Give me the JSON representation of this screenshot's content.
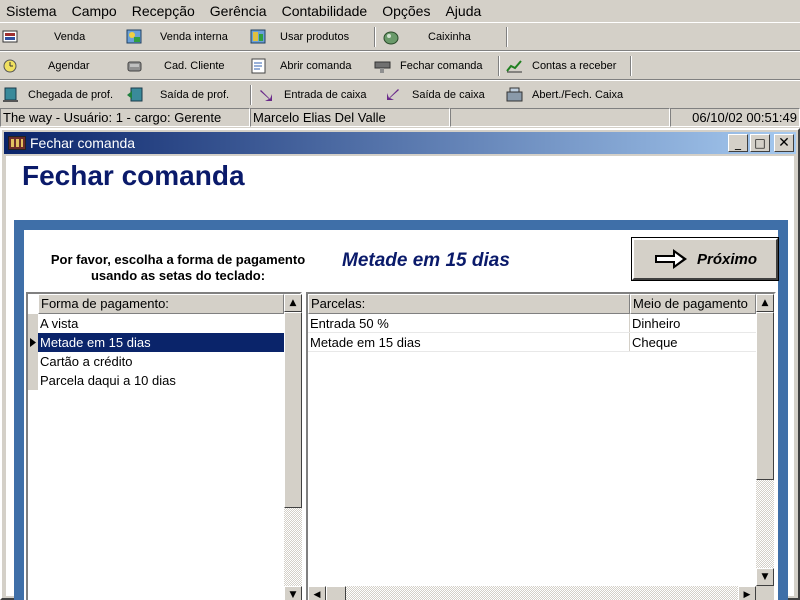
{
  "menu": [
    "Sistema",
    "Campo",
    "Recepção",
    "Gerência",
    "Contabilidade",
    "Opções",
    "Ajuda"
  ],
  "toolbar": {
    "row1": [
      {
        "label": "Venda",
        "icon": "sale-icon"
      },
      {
        "label": "Venda interna",
        "icon": "internal-sale-icon"
      },
      {
        "label": "Usar produtos",
        "icon": "products-icon"
      },
      {
        "label": "Caixinha",
        "icon": "tip-box-icon"
      }
    ],
    "row2": [
      {
        "label": "Agendar",
        "icon": "schedule-icon"
      },
      {
        "label": "Cad. Cliente",
        "icon": "client-register-icon"
      },
      {
        "label": "Abrir comanda",
        "icon": "open-order-icon"
      },
      {
        "label": "Fechar comanda",
        "icon": "close-order-icon"
      },
      {
        "label": "Contas a receber",
        "icon": "receivables-icon"
      }
    ],
    "row3": [
      {
        "label": "Chegada de prof.",
        "icon": "professional-arrival-icon"
      },
      {
        "label": "Saída de prof.",
        "icon": "professional-exit-icon"
      },
      {
        "label": "Entrada de caixa",
        "icon": "cash-in-icon"
      },
      {
        "label": "Saída de caixa",
        "icon": "cash-out-icon"
      },
      {
        "label": "Abert./Fech. Caixa",
        "icon": "cash-register-icon"
      }
    ]
  },
  "status": {
    "user_info": "The way - Usuário: 1 - cargo: Gerente",
    "user_name": "Marcelo Elias Del Valle",
    "blank": "",
    "datetime": "06/10/02 00:51:49"
  },
  "window": {
    "title": "Fechar comanda",
    "minimize": "_",
    "maximize": "□",
    "close": "✕"
  },
  "page": {
    "heading": "Fechar comanda",
    "prompt_line1": "Por favor, escolha a forma de pagamento",
    "prompt_line2": "usando as setas do teclado:",
    "selected_method": "Metade em 15 dias",
    "next_label": "Próximo"
  },
  "payment_list": {
    "header": "Forma de pagamento:",
    "items": [
      "A vista",
      "Metade em 15 dias",
      "Cartão a crédito",
      "Parcela daqui a 10 dias"
    ],
    "selected_index": 1
  },
  "installments": {
    "headers": [
      "Parcelas:",
      "Meio de pagamento"
    ],
    "rows": [
      [
        "Entrada 50 %",
        "Dinheiro"
      ],
      [
        "Metade em 15 dias",
        "Cheque"
      ]
    ]
  },
  "colors": {
    "heading": "#0a1a6a",
    "selection": "#0a246a",
    "frame": "#3f6fa8"
  }
}
